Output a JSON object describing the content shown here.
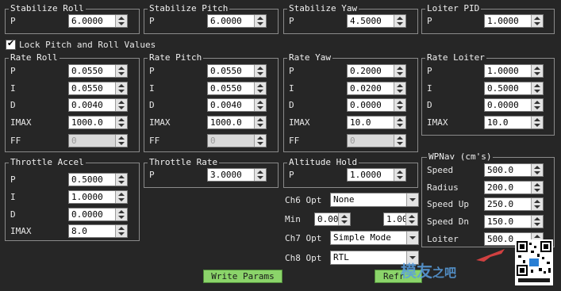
{
  "groups": {
    "stabilize_roll": {
      "title": "Stabilize Roll",
      "p_label": "P",
      "p_value": "6.0000"
    },
    "stabilize_pitch": {
      "title": "Stabilize Pitch",
      "p_label": "P",
      "p_value": "6.0000"
    },
    "stabilize_yaw": {
      "title": "Stabilize Yaw",
      "p_label": "P",
      "p_value": "4.5000"
    },
    "loiter_pid": {
      "title": "Loiter PID",
      "p_label": "P",
      "p_value": "1.0000"
    },
    "rate_roll": {
      "title": "Rate Roll",
      "labels": [
        "P",
        "I",
        "D",
        "IMAX",
        "FF"
      ],
      "values": [
        "0.0550",
        "0.0550",
        "0.0040",
        "1000.0",
        "0"
      ]
    },
    "rate_pitch": {
      "title": "Rate Pitch",
      "labels": [
        "P",
        "I",
        "D",
        "IMAX",
        "FF"
      ],
      "values": [
        "0.0550",
        "0.0550",
        "0.0040",
        "1000.0",
        "0"
      ]
    },
    "rate_yaw": {
      "title": "Rate Yaw",
      "labels": [
        "P",
        "I",
        "D",
        "IMAX",
        "FF"
      ],
      "values": [
        "0.2000",
        "0.0200",
        "0.0000",
        "10.0",
        "0"
      ]
    },
    "rate_loiter": {
      "title": "Rate Loiter",
      "labels": [
        "P",
        "I",
        "D",
        "IMAX"
      ],
      "values": [
        "1.0000",
        "0.5000",
        "0.0000",
        "10.0"
      ]
    },
    "throttle_accel": {
      "title": "Throttle Accel",
      "labels": [
        "P",
        "I",
        "D",
        "IMAX"
      ],
      "values": [
        "0.5000",
        "1.0000",
        "0.0000",
        "8.0"
      ]
    },
    "throttle_rate": {
      "title": "Throttle Rate",
      "p_label": "P",
      "p_value": "3.0000"
    },
    "altitude_hold": {
      "title": "Altitude Hold",
      "p_label": "P",
      "p_value": "1.0000"
    },
    "wpnav": {
      "title": "WPNav (cm's)",
      "labels": [
        "Speed",
        "Radius",
        "Speed Up",
        "Speed Dn",
        "Loiter"
      ],
      "values": [
        "500.0",
        "200.0",
        "250.0",
        "150.0",
        "500.0"
      ]
    }
  },
  "lock_checkbox": {
    "label": "Lock Pitch and Roll Values",
    "checked": true
  },
  "ch6": {
    "label": "Ch6 Opt",
    "value": "None"
  },
  "min_max": {
    "label": "Min",
    "min_value": "0.000",
    "max_value": "1.000"
  },
  "ch7": {
    "label": "Ch7 Opt",
    "value": "Simple Mode"
  },
  "ch8": {
    "label": "Ch8 Opt",
    "value": "RTL"
  },
  "buttons": {
    "write": "Write Params",
    "refresh": "Refr"
  },
  "watermark": {
    "text_a": "模友",
    "text_b": "之吧"
  },
  "colors": {
    "background": "#262626",
    "button": "#8bd46a",
    "field": "#ffffff"
  }
}
